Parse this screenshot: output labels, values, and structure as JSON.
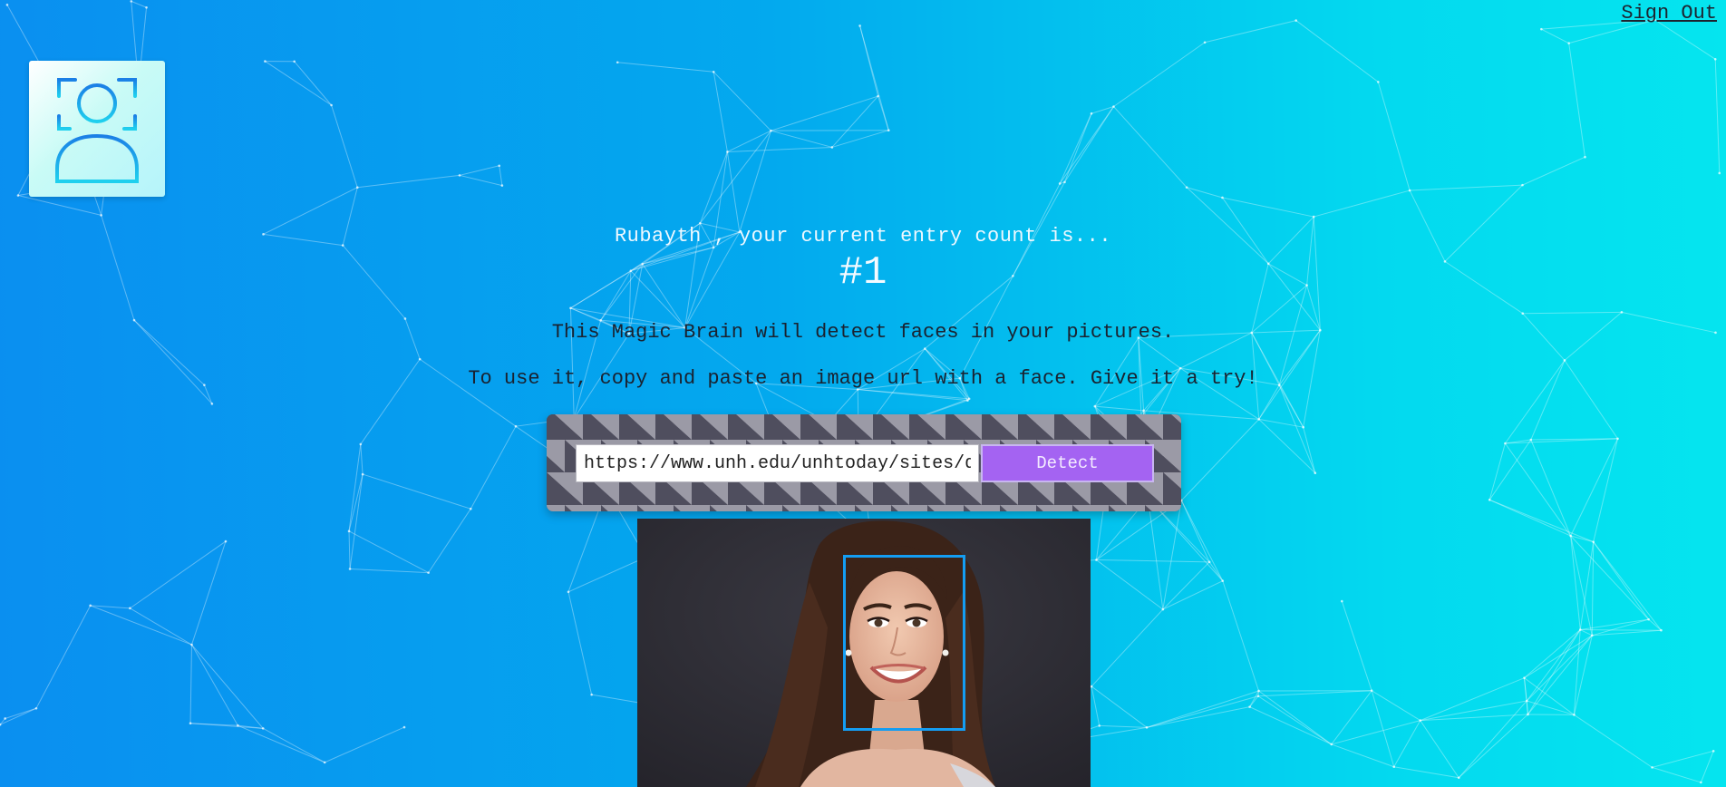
{
  "nav": {
    "signout_label": "Sign Out"
  },
  "logo": {
    "icon": "face-scan-icon"
  },
  "rank": {
    "greeting": "Rubayth , your current entry count is...",
    "count": "#1"
  },
  "intro": {
    "line1": "This Magic Brain will detect faces in your pictures.",
    "line2": "To use it, copy and paste an image url with a face. Give it a try!"
  },
  "form": {
    "url_value": "https://www.unh.edu/unhtoday/sites/default/files/styles/",
    "button_label": "Detect"
  },
  "colors": {
    "button": "#a463f2",
    "face_box": "#149df2",
    "background_start": "#0a8ff0",
    "background_end": "#05e5ef"
  }
}
